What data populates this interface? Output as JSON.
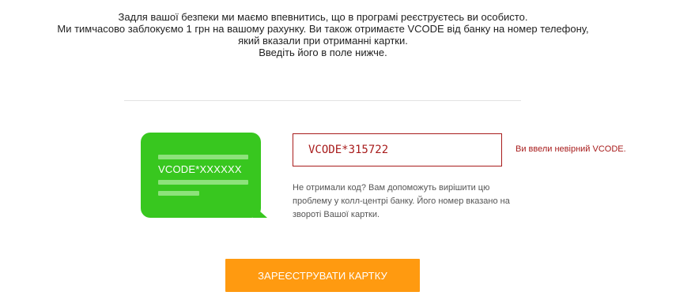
{
  "intro": {
    "line1": "Задля вашої безпеки ми маємо впевнитись, що в програмі реєструєтесь ви особисто.",
    "line2": "Ми тимчасово заблокуємо 1 грн на вашому рахунку. Ви також отримаєте VCODE від банку на номер телефону,",
    "line3": "який вказали при отриманні картки.",
    "line4": "Введіть його в поле нижче."
  },
  "illustration": {
    "code_example": "VCODE*XXXXXX",
    "bubble_color": "#38c71f"
  },
  "vcode": {
    "value": "VCODE*315722",
    "error": "Ви ввели невірний VCODE.",
    "hint": "Не отримали код? Вам допоможуть вирішити цю проблему у колл-центрі банку. Його номер вказано на звороті Вашої картки."
  },
  "submit": {
    "label": "ЗАРЕЄСТРУВАТИ КАРТКУ"
  },
  "colors": {
    "accent": "#ff9a10",
    "error": "#a81c1c"
  }
}
